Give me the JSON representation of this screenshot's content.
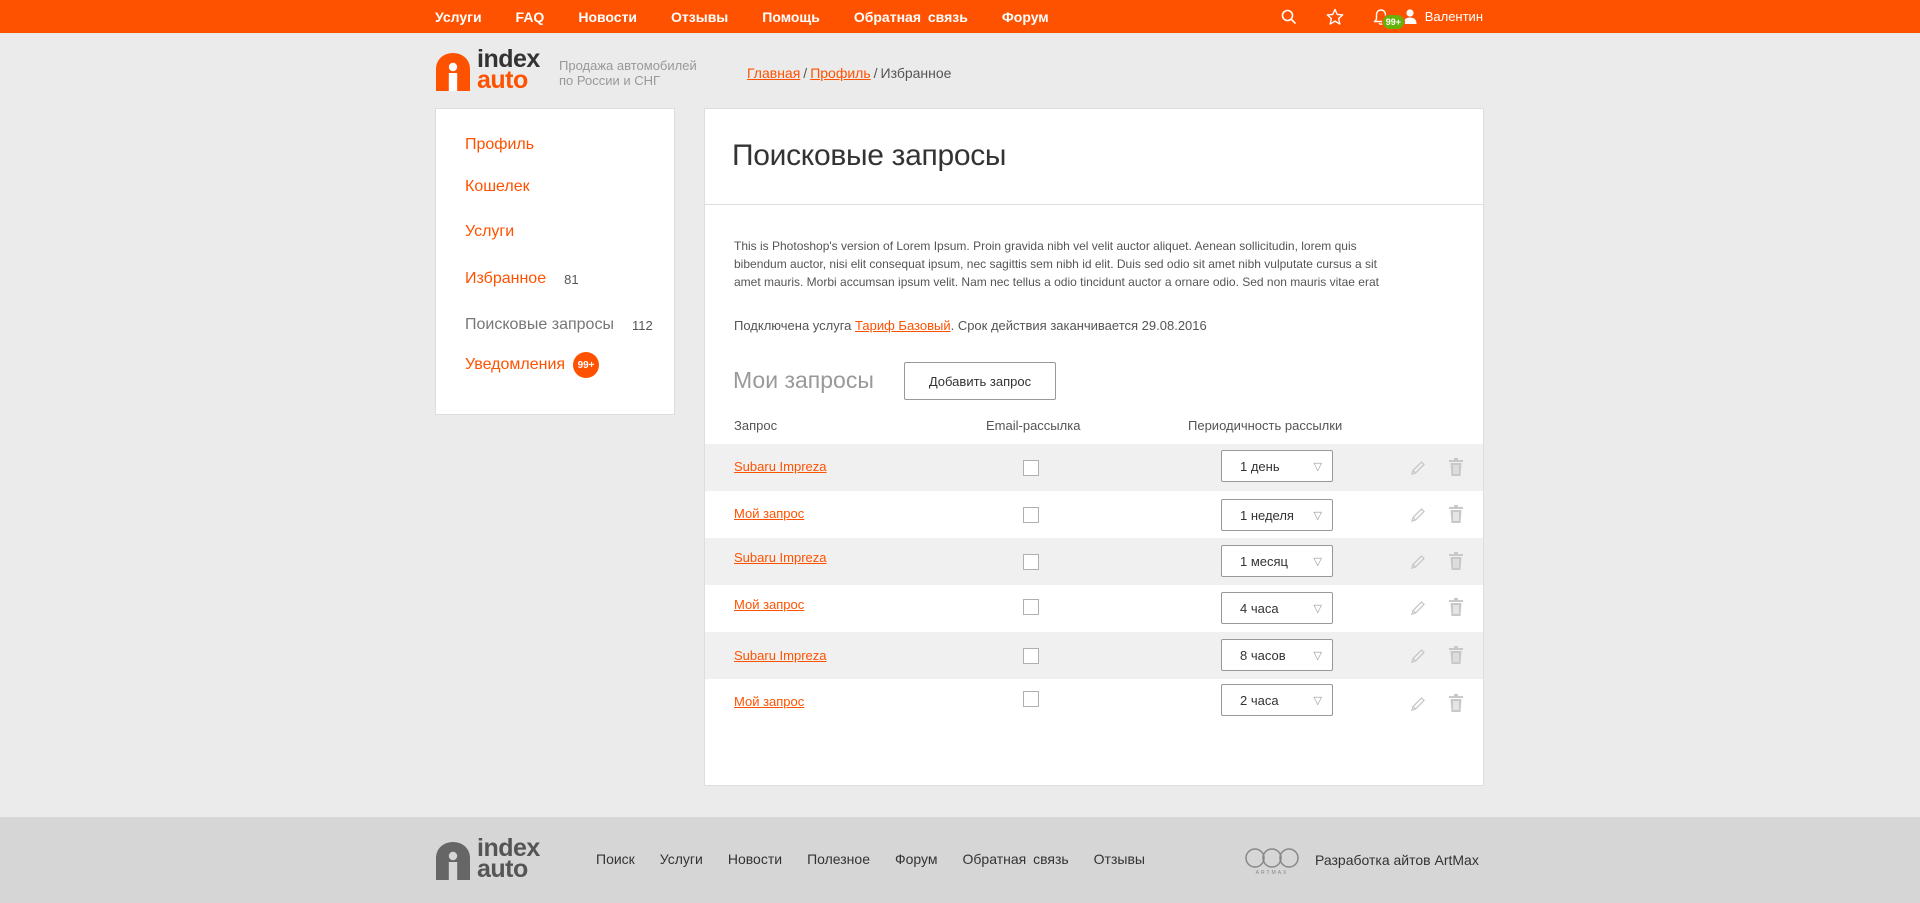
{
  "topnav": {
    "items": [
      "Услуги",
      "FAQ",
      "Новости",
      "Отзывы",
      "Помощь",
      "Обратная связь",
      "Форум"
    ],
    "icons": [
      "search-icon",
      "star-icon",
      "bell-icon",
      "user-icon"
    ],
    "notif_badge": "99+",
    "user_name": "Валентин",
    "accent": "#ff5200",
    "badge_green": "#67b10a"
  },
  "header": {
    "logo_line1": "index",
    "logo_line2": "auto",
    "tagline_line1": "Продажа автомобилей",
    "tagline_line2": "по России и СНГ",
    "breadcrumb": {
      "home": "Главная",
      "profile": "Профиль",
      "current": "Избранное",
      "sep": "/"
    }
  },
  "sidebar": {
    "items": [
      {
        "label": "Профиль"
      },
      {
        "label": "Кошелек"
      },
      {
        "label": "Услуги"
      },
      {
        "label": "Избранное",
        "count": "81"
      },
      {
        "label": "Поисковые запросы",
        "count": "112"
      },
      {
        "label": "Уведомления",
        "badge": "99+"
      }
    ]
  },
  "main": {
    "title": "Поисковые запросы",
    "lorem_1": "This is Photoshop's version  of Lorem Ipsum. Proin gravida nibh vel velit auctor aliquet. Aenean sollicitudin, lorem quis",
    "lorem_2": "bibendum auctor, nisi elit consequat ipsum, nec sagittis sem nibh id elit. Duis sed odio sit amet nibh vulputate cursus a sit",
    "lorem_3": "amet mauris. Morbi accumsan ipsum velit. Nam nec tellus a odio tincidunt auctor a ornare odio. Sed non  mauris vitae erat",
    "service_prefix": "Подключена услуга",
    "service_link": "Тариф Базовый",
    "service_suffix": ". Срок действия заканчивается 29.08.2016",
    "my_requests": "Мои запросы",
    "add_button": "Добавить запрос",
    "columns": [
      "Запрос",
      "Email-рассылка",
      "Периодичность рассылки"
    ],
    "rows": [
      {
        "query": "Subaru Impreza",
        "email": false,
        "period": "1 день"
      },
      {
        "query": "Мой запрос",
        "email": false,
        "period": "1 неделя"
      },
      {
        "query": "Subaru Impreza",
        "email": false,
        "period": "1 месяц"
      },
      {
        "query": "Мой запрос",
        "email": false,
        "period": "4 часа"
      },
      {
        "query": "Subaru Impreza",
        "email": false,
        "period": "8 часов"
      },
      {
        "query": "Мой запрос",
        "email": false,
        "period": "2 часа"
      }
    ],
    "row_icons": [
      "pencil-icon",
      "trash-icon"
    ]
  },
  "footer": {
    "logo_line1": "index",
    "logo_line2": "auto",
    "nav": [
      "Поиск",
      "Услуги",
      "Новости",
      "Полезное",
      "Форум",
      "Обратная связь",
      "Отзывы"
    ],
    "developer": "Разработка айтов ArtMax",
    "dev_logo_text": "ARTMAX"
  }
}
